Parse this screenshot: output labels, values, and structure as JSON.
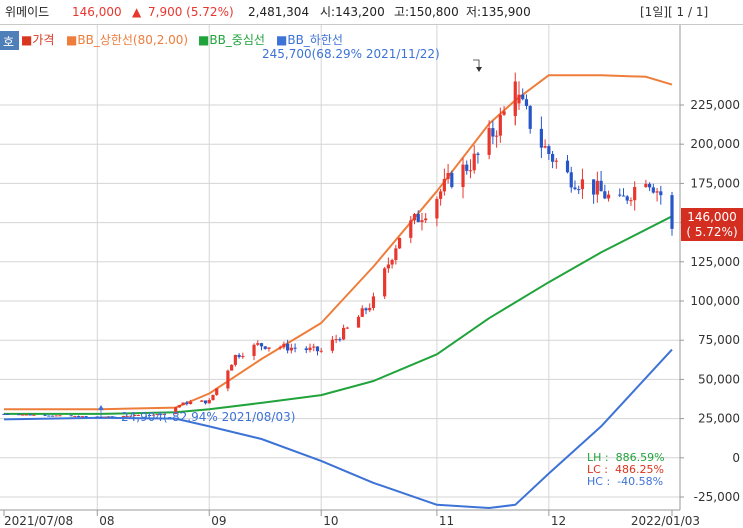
{
  "header": {
    "name": "위메이드",
    "price": "146,000",
    "change_arrow": "▲",
    "change": "7,900 (5.72%)",
    "volume": "2,481,304",
    "open": "시:143,200",
    "high": "고:150,800",
    "low": "저:135,900",
    "pager": "[1일][ 1 / 1]",
    "colors": {
      "up": "#e8372f",
      "down": "#2756c9"
    }
  },
  "toolbar": {
    "badge": "호"
  },
  "legend": {
    "price": "■가격",
    "upper": "■BB_상한선(80,2.00)",
    "middle": "■BB_중심선",
    "lower": "■BB_하한선",
    "colors": {
      "price": "#d9361f",
      "upper": "#ee7d3b",
      "middle": "#21a33c",
      "lower": "#3d73d6"
    }
  },
  "annotations": {
    "high": "245,700(68.29% 2021/11/22)",
    "low": "24,904(-82.94% 2021/08/03)"
  },
  "price_tag": {
    "value": "146,000",
    "change": "( 5.72%)",
    "color": "#d42e20"
  },
  "stats": {
    "lh": "LH :  886.59%",
    "lc": "LC :  486.25%",
    "hc": "HC :  -40.58%"
  },
  "chart_data": {
    "type": "candlestick",
    "x_tick_labels": [
      "2021/07/08",
      "08",
      "09",
      "10",
      "11",
      "12",
      "2022/01/03"
    ],
    "y_tick_labels": [
      "-25,000",
      "0",
      "25,000",
      "50,000",
      "75,000",
      "100,000",
      "125,000",
      "150,000",
      "175,000",
      "200,000",
      "225,000"
    ],
    "ylim": [
      -35000,
      262000
    ],
    "y_ticks": [
      -25000,
      0,
      25000,
      50000,
      75000,
      100000,
      125000,
      150000,
      175000,
      200000,
      225000
    ],
    "grid": true,
    "legend_position": "top-left",
    "series": [
      {
        "name": "가격",
        "kind": "candlestick",
        "description": "Daily OHLC candles, red = up day, blue = down day"
      },
      {
        "name": "BB_상한선(80,2.00)",
        "kind": "line",
        "x": [
          "2021-07-08",
          "2021-08-03",
          "2021-08-23",
          "2021-09-01",
          "2021-09-15",
          "2021-10-01",
          "2021-10-15",
          "2021-11-01",
          "2021-11-15",
          "2021-11-22",
          "2021-12-01",
          "2021-12-15",
          "2021-12-27",
          "2022-01-03"
        ],
        "y": [
          31000,
          31000,
          32000,
          41000,
          63000,
          86000,
          122000,
          170000,
          213000,
          228000,
          244000,
          244000,
          243000,
          238000
        ]
      },
      {
        "name": "BB_중심선",
        "kind": "line",
        "x": [
          "2021-07-08",
          "2021-08-03",
          "2021-08-23",
          "2021-09-01",
          "2021-09-15",
          "2021-10-01",
          "2021-10-15",
          "2021-11-01",
          "2021-11-15",
          "2021-12-01",
          "2021-12-15",
          "2022-01-03"
        ],
        "y": [
          28000,
          28000,
          29000,
          31000,
          35000,
          40000,
          49000,
          66000,
          89000,
          112000,
          131000,
          154000
        ]
      },
      {
        "name": "BB_하한선",
        "kind": "line",
        "x": [
          "2021-07-08",
          "2021-08-03",
          "2021-08-23",
          "2021-09-01",
          "2021-09-15",
          "2021-10-01",
          "2021-10-15",
          "2021-11-01",
          "2021-11-15",
          "2021-11-22",
          "2021-12-01",
          "2021-12-15",
          "2022-01-03"
        ],
        "y": [
          24500,
          25500,
          25000,
          20000,
          12000,
          -2000,
          -16000,
          -30000,
          -32000,
          -30000,
          -10000,
          20000,
          69000
        ]
      }
    ],
    "annotations": [
      {
        "text": "245,700(68.29% 2021/11/22)",
        "x": "2021-11-22",
        "y": 245700
      },
      {
        "text": "24,904(-82.94% 2021/08/03)",
        "x": "2021-08-03",
        "y": 24904
      }
    ],
    "last_value": {
      "price": 146000,
      "change_pct": 5.72
    }
  }
}
